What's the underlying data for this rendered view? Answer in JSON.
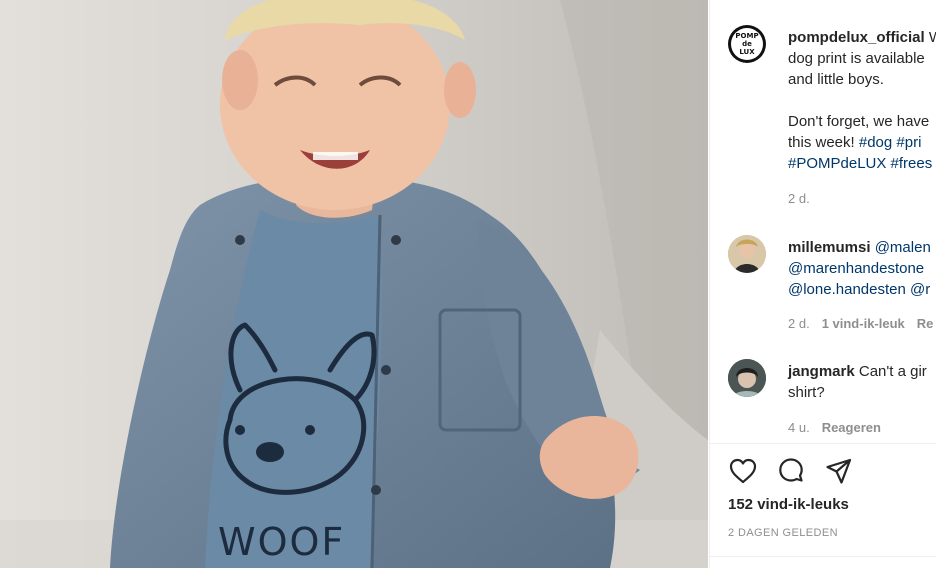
{
  "post": {
    "author": "pompdelux_official",
    "avatar_text": "POMP de LUX",
    "caption_lines": [
      "dog print is available",
      "and little boys."
    ],
    "caption_lead": "W",
    "caption2_line1": "Don't forget, we have",
    "caption2_line2_text": "this week! ",
    "caption2_tags_line2": "#dog #pri",
    "caption2_tags_line3": "#POMPdeLUX #frees",
    "time": "2 d."
  },
  "comments": [
    {
      "user": "millemumsi",
      "line1_mention": "@malen",
      "line2": "@marenhandestone",
      "line3": "@lone.handesten @r",
      "time": "2 d.",
      "likes": "1 vind-ik-leuk",
      "reply": "Re"
    },
    {
      "user": "jangmark",
      "line1": "Can't a gir",
      "line2": "shirt?",
      "time": "4 u.",
      "reply": "Reageren"
    }
  ],
  "actions": {
    "like_icon": "heart-icon",
    "comment_icon": "comment-icon",
    "share_icon": "paper-plane-icon"
  },
  "likes_count": "152 vind-ik-leuks",
  "posted_date": "2 DAGEN GELEDEN",
  "photo": {
    "print_text": "WOOF"
  }
}
